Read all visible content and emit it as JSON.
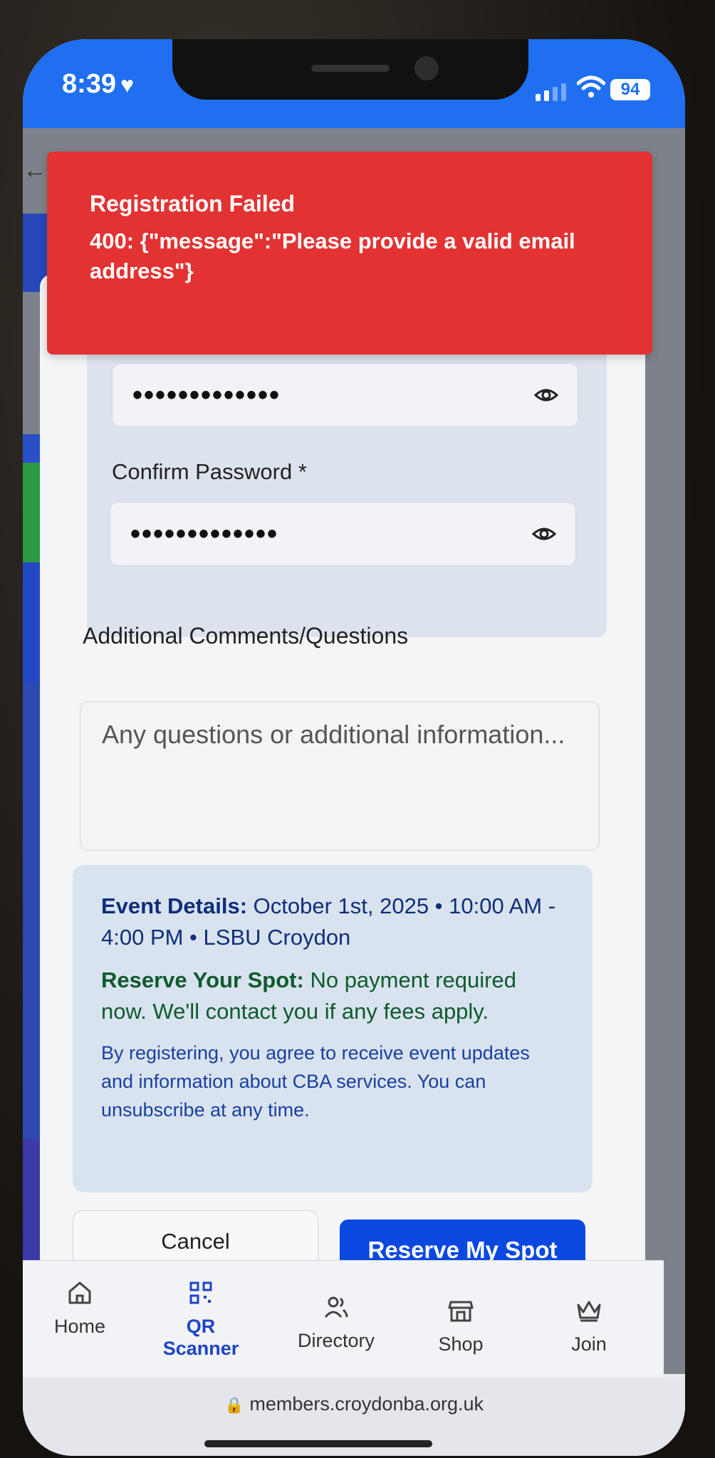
{
  "status_bar": {
    "time": "8:39",
    "battery": "94"
  },
  "toast": {
    "title": "Registration Failed",
    "message": "400: {\"message\":\"Please provide a valid email address\"}"
  },
  "form": {
    "password_value": "•••••••••••••",
    "confirm_password_label": "Confirm Password *",
    "confirm_password_value": "•••••••••••••",
    "comments_label": "Additional Comments/Questions",
    "comments_placeholder": "Any questions or additional information..."
  },
  "info_box": {
    "event_label": "Event Details:",
    "event_text": "October 1st, 2025 • 10:00 AM - 4:00 PM • LSBU Croydon",
    "reserve_label": "Reserve Your Spot:",
    "reserve_text": "No payment required now. We'll contact you if any fees apply.",
    "terms": "By registering, you agree to receive event updates and information about CBA services. You can unsubscribe at any time."
  },
  "buttons": {
    "cancel": "Cancel",
    "reserve": "Reserve My Spot"
  },
  "bottom_nav": {
    "items": [
      {
        "label": "Home",
        "icon": "home-icon",
        "active": false
      },
      {
        "label": "QR Scanner",
        "icon": "qr-code-icon",
        "active": true
      },
      {
        "label": "Directory",
        "icon": "users-icon",
        "active": false
      },
      {
        "label": "Shop",
        "icon": "store-icon",
        "active": false
      },
      {
        "label": "Join",
        "icon": "crown-icon",
        "active": false
      }
    ]
  },
  "browser": {
    "url": "members.croydonba.org.uk"
  },
  "colors": {
    "status_bar": "#1f6ff0",
    "toast_bg": "#e33232",
    "primary_button": "#0a48e0",
    "active_nav": "#1d44c8",
    "event_details_text": "#0e2e7a",
    "reserve_text": "#0f5a2c"
  }
}
